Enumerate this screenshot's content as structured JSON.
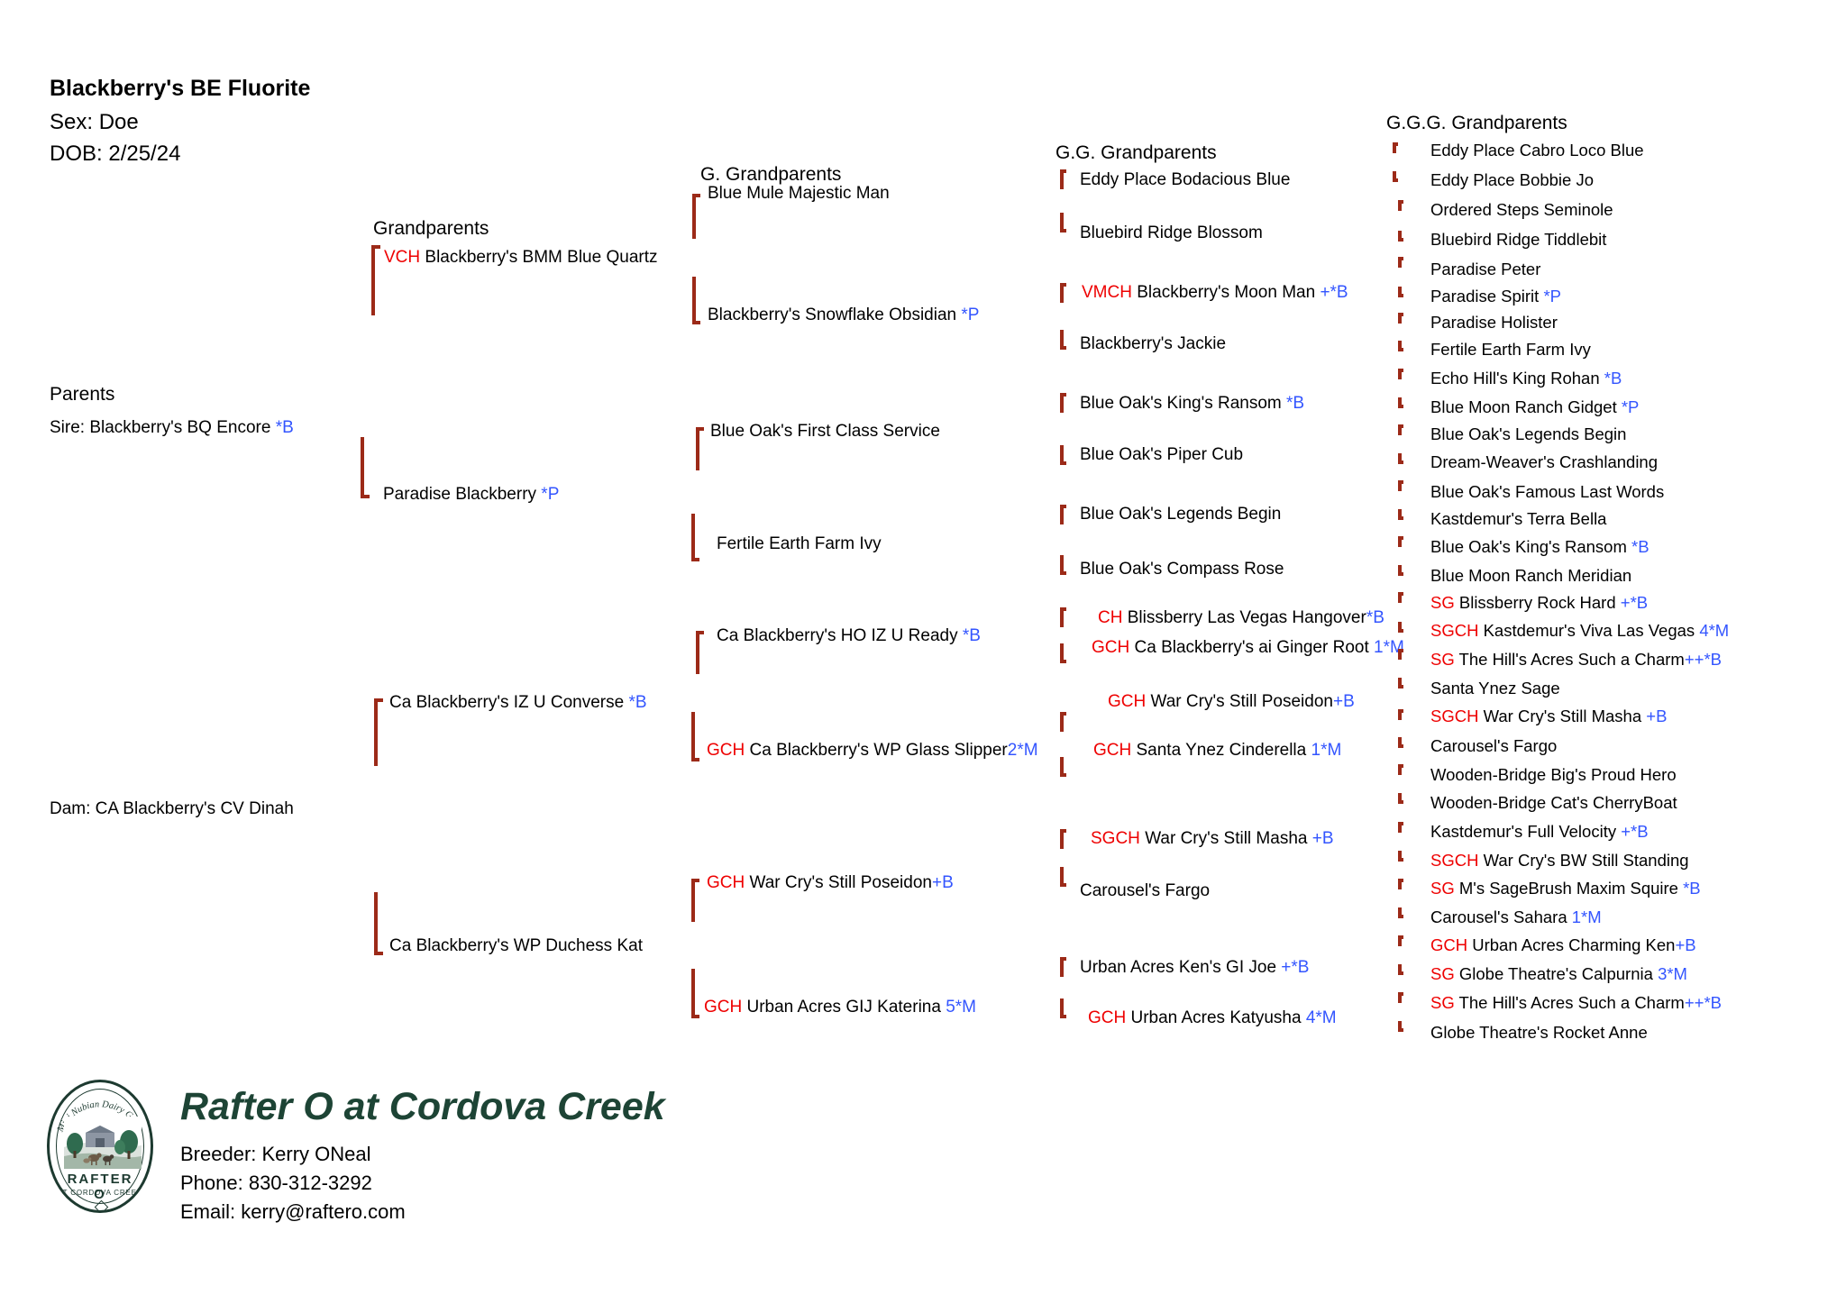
{
  "subject": {
    "name": "Blackberry's BE Fluorite",
    "sex_label": "Sex: Doe",
    "dob_label": "DOB: 2/25/24"
  },
  "columns": {
    "parents": "Parents",
    "grandparents": "Grandparents",
    "g_grandparents": "G. Grandparents",
    "gg_grandparents": "G.G. Grandparents",
    "ggg_grandparents": "G.G.G. Grandparents"
  },
  "parents": [
    {
      "prefix": "",
      "name": "Sire: Blackberry's BQ Encore ",
      "suffix": "*B"
    },
    {
      "prefix": "",
      "name": "Dam: CA Blackberry's CV Dinah",
      "suffix": ""
    }
  ],
  "grandparents": [
    {
      "prefix": "VCH ",
      "name": "Blackberry's BMM Blue Quartz",
      "suffix": ""
    },
    {
      "prefix": "",
      "name": "Paradise Blackberry ",
      "suffix": "*P"
    },
    {
      "prefix": "",
      "name": "Ca Blackberry's IZ U Converse ",
      "suffix": "*B"
    },
    {
      "prefix": "",
      "name": "Ca Blackberry's WP Duchess Kat",
      "suffix": ""
    }
  ],
  "g_grandparents": [
    {
      "prefix": "",
      "name": "Blue Mule Majestic Man",
      "suffix": ""
    },
    {
      "prefix": "",
      "name": "Blackberry's Snowflake Obsidian ",
      "suffix": "*P"
    },
    {
      "prefix": "",
      "name": "Blue Oak's First Class Service",
      "suffix": ""
    },
    {
      "prefix": "",
      "name": "Fertile Earth Farm Ivy",
      "suffix": ""
    },
    {
      "prefix": "",
      "name": "Ca Blackberry's HO IZ U Ready ",
      "suffix": "*B"
    },
    {
      "prefix": "GCH ",
      "name": "Ca Blackberry's WP Glass Slipper",
      "suffix": "2*M"
    },
    {
      "prefix": "GCH ",
      "name": "War Cry's Still Poseidon",
      "suffix": "+B"
    },
    {
      "prefix": "GCH ",
      "name": "Urban Acres GIJ Katerina ",
      "suffix": "5*M"
    }
  ],
  "gg_grandparents": [
    {
      "prefix": "",
      "name": "Eddy Place Bodacious Blue",
      "suffix": ""
    },
    {
      "prefix": "",
      "name": "Bluebird Ridge Blossom",
      "suffix": ""
    },
    {
      "prefix": "VMCH ",
      "name": "Blackberry's Moon Man ",
      "suffix": "+*B"
    },
    {
      "prefix": "",
      "name": "Blackberry's Jackie",
      "suffix": ""
    },
    {
      "prefix": "",
      "name": "Blue Oak's King's Ransom ",
      "suffix": "*B"
    },
    {
      "prefix": "",
      "name": "Blue Oak's Piper Cub",
      "suffix": ""
    },
    {
      "prefix": "",
      "name": "Blue Oak's Legends Begin",
      "suffix": ""
    },
    {
      "prefix": "",
      "name": "Blue Oak's Compass Rose",
      "suffix": ""
    },
    {
      "prefix": "CH ",
      "name": "Blissberry Las Vegas Hangover",
      "suffix": "*B"
    },
    {
      "prefix": "GCH ",
      "name": "Ca Blackberry's ai Ginger Root ",
      "suffix": "1*M"
    },
    {
      "prefix": "GCH ",
      "name": "War Cry's Still Poseidon",
      "suffix": "+B"
    },
    {
      "prefix": "GCH ",
      "name": "Santa Ynez Cinderella ",
      "suffix": "1*M"
    },
    {
      "prefix": "SGCH ",
      "name": "War Cry's Still Masha ",
      "suffix": "+B"
    },
    {
      "prefix": "",
      "name": "Carousel's Fargo",
      "suffix": ""
    },
    {
      "prefix": "",
      "name": "Urban Acres Ken's GI Joe ",
      "suffix": "+*B"
    },
    {
      "prefix": "GCH ",
      "name": "Urban Acres Katyusha ",
      "suffix": "4*M"
    }
  ],
  "ggg_grandparents": [
    {
      "prefix": "",
      "name": "Eddy Place Cabro Loco Blue",
      "suffix": ""
    },
    {
      "prefix": "",
      "name": "Eddy Place Bobbie Jo",
      "suffix": ""
    },
    {
      "prefix": "",
      "name": "Ordered Steps Seminole",
      "suffix": ""
    },
    {
      "prefix": "",
      "name": "Bluebird Ridge Tiddlebit",
      "suffix": ""
    },
    {
      "prefix": "",
      "name": "Paradise Peter",
      "suffix": ""
    },
    {
      "prefix": "",
      "name": "Paradise Spirit ",
      "suffix": "*P"
    },
    {
      "prefix": "",
      "name": " Paradise Holister",
      "suffix": ""
    },
    {
      "prefix": "",
      "name": "Fertile Earth Farm Ivy",
      "suffix": ""
    },
    {
      "prefix": "",
      "name": "Echo Hill's King Rohan ",
      "suffix": "*B"
    },
    {
      "prefix": "",
      "name": "Blue Moon Ranch Gidget ",
      "suffix": "*P"
    },
    {
      "prefix": "",
      "name": "Blue Oak's Legends Begin",
      "suffix": ""
    },
    {
      "prefix": "",
      "name": "Dream-Weaver's Crashlanding",
      "suffix": ""
    },
    {
      "prefix": "",
      "name": "Blue Oak's Famous Last Words",
      "suffix": ""
    },
    {
      "prefix": "",
      "name": " Kastdemur's Terra Bella",
      "suffix": ""
    },
    {
      "prefix": "",
      "name": "Blue Oak's King's Ransom ",
      "suffix": "*B"
    },
    {
      "prefix": "",
      "name": "Blue Moon Ranch Meridian",
      "suffix": ""
    },
    {
      "prefix": "SG ",
      "name": "Blissberry Rock Hard ",
      "suffix": "+*B"
    },
    {
      "prefix": "SGCH ",
      "name": "Kastdemur's Viva Las Vegas ",
      "suffix": "4*M"
    },
    {
      "prefix": " SG ",
      "name": "The Hill's Acres Such a Charm",
      "suffix": "++*B"
    },
    {
      "prefix": "",
      "name": "Santa Ynez Sage",
      "suffix": ""
    },
    {
      "prefix": "SGCH ",
      "name": "War Cry's Still Masha ",
      "suffix": "+B"
    },
    {
      "prefix": "",
      "name": "Carousel's Fargo",
      "suffix": ""
    },
    {
      "prefix": "",
      "name": "Wooden-Bridge Big's Proud Hero",
      "suffix": ""
    },
    {
      "prefix": "",
      "name": "Wooden-Bridge Cat's CherryBoat",
      "suffix": ""
    },
    {
      "prefix": "",
      "name": "Kastdemur's Full Velocity ",
      "suffix": "+*B"
    },
    {
      "prefix": "SGCH ",
      "name": "War Cry's BW Still Standing",
      "suffix": ""
    },
    {
      "prefix": "SG ",
      "name": "M's SageBrush Maxim Squire ",
      "suffix": "*B"
    },
    {
      "prefix": "",
      "name": "Carousel's Sahara ",
      "suffix": "1*M"
    },
    {
      "prefix": "GCH ",
      "name": "Urban Acres Charming Ken",
      "suffix": "+B"
    },
    {
      "prefix": "SG ",
      "name": "Globe Theatre's Calpurnia ",
      "suffix": "3*M"
    },
    {
      "prefix": " SG ",
      "name": "The Hill's Acres Such a Charm",
      "suffix": "++*B"
    },
    {
      "prefix": "",
      "name": "Globe Theatre's Rocket Anne",
      "suffix": ""
    }
  ],
  "footer": {
    "farm_name": "Rafter O at Cordova Creek",
    "breeder": "Breeder: Kerry ONeal",
    "phone": "Phone: 830-312-3292",
    "email": "Email: kerry@raftero.com",
    "logo": {
      "arc_text": "Mini Nubian Dairy Goats",
      "band_text": "RAFTER O",
      "sub_text": "AT CORDOVA CREEK"
    }
  },
  "colors": {
    "prefix_red": "#ee0000",
    "suffix_blue": "#3355ff",
    "bracket": "#9c2a18",
    "farm_green": "#1d4435"
  }
}
